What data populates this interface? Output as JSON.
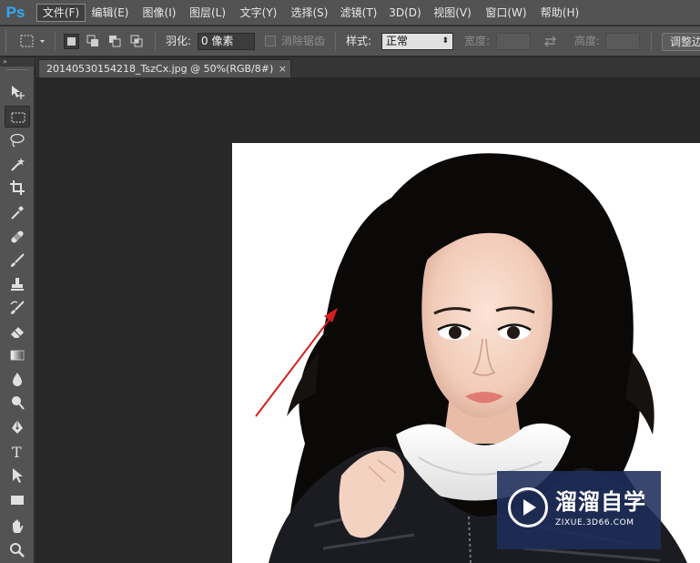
{
  "app": {
    "logo": "Ps"
  },
  "menu": [
    {
      "label": "文件(F)",
      "active": true
    },
    {
      "label": "编辑(E)"
    },
    {
      "label": "图像(I)"
    },
    {
      "label": "图层(L)"
    },
    {
      "label": "文字(Y)"
    },
    {
      "label": "选择(S)"
    },
    {
      "label": "滤镜(T)"
    },
    {
      "label": "3D(D)"
    },
    {
      "label": "视图(V)"
    },
    {
      "label": "窗口(W)"
    },
    {
      "label": "帮助(H)"
    }
  ],
  "options": {
    "feather_label": "羽化:",
    "feather_value": "0 像素",
    "antialias_label": "消除锯齿",
    "style_label": "样式:",
    "style_value": "正常",
    "width_label": "宽度:",
    "height_label": "高度:",
    "refine_button": "调整边"
  },
  "toolbox": {
    "header": "»",
    "tools": [
      {
        "name": "move-tool",
        "icon": "move-icon"
      },
      {
        "name": "marquee-tool",
        "icon": "rect-marquee-icon",
        "active": true
      },
      {
        "name": "lasso-tool",
        "icon": "lasso-icon"
      },
      {
        "name": "magic-wand-tool",
        "icon": "magic-wand-icon"
      },
      {
        "name": "crop-tool",
        "icon": "crop-icon"
      },
      {
        "name": "eyedropper-tool",
        "icon": "eyedropper-icon"
      },
      {
        "name": "healing-brush-tool",
        "icon": "bandage-icon"
      },
      {
        "name": "brush-tool",
        "icon": "brush-icon"
      },
      {
        "name": "clone-stamp-tool",
        "icon": "stamp-icon"
      },
      {
        "name": "history-brush-tool",
        "icon": "history-brush-icon"
      },
      {
        "name": "eraser-tool",
        "icon": "eraser-icon"
      },
      {
        "name": "gradient-tool",
        "icon": "gradient-icon"
      },
      {
        "name": "blur-tool",
        "icon": "drop-icon"
      },
      {
        "name": "dodge-tool",
        "icon": "dodge-icon"
      },
      {
        "name": "pen-tool",
        "icon": "pen-icon"
      },
      {
        "name": "type-tool",
        "icon": "type-icon",
        "glyph": "T"
      },
      {
        "name": "path-selection-tool",
        "icon": "arrow-icon"
      },
      {
        "name": "shape-tool",
        "icon": "rectangle-icon"
      },
      {
        "name": "hand-tool",
        "icon": "hand-icon"
      },
      {
        "name": "zoom-tool",
        "icon": "zoom-icon"
      }
    ]
  },
  "document": {
    "tab_title": "20140530154218_TszCx.jpg @ 50%(RGB/8#)",
    "close_glyph": "×"
  },
  "watermark": {
    "title": "溜溜自学",
    "url": "ZIXUE.3D66.COM"
  },
  "colors": {
    "panel": "#535353",
    "canvas_bg": "#282828",
    "accent_ps": "#31a8ff",
    "annotation_arrow": "#d42020",
    "watermark_bg": "#1e2d5a"
  }
}
